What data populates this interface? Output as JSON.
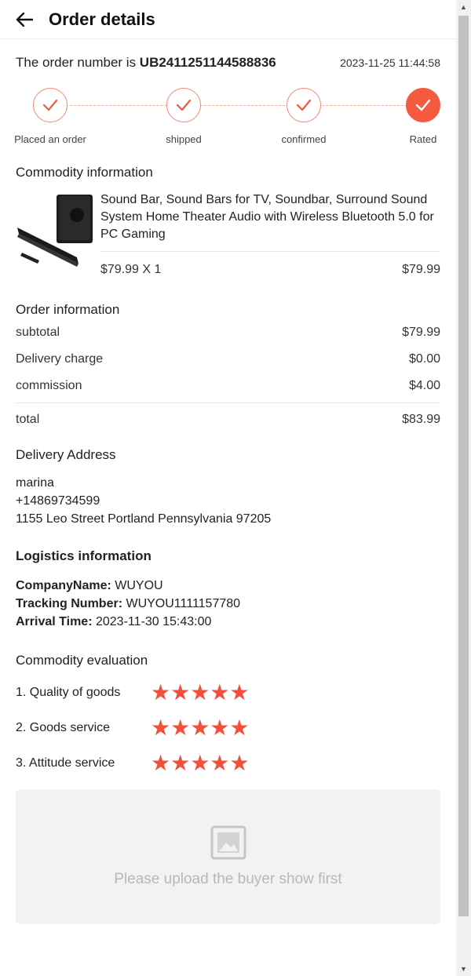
{
  "header": {
    "title": "Order details"
  },
  "order": {
    "label": "The order number is ",
    "number": "UB2411251144588836",
    "time": "2023-11-25 11:44:58"
  },
  "steps": [
    {
      "label": "Placed an order",
      "filled": false
    },
    {
      "label": "shipped",
      "filled": false
    },
    {
      "label": "confirmed",
      "filled": false
    },
    {
      "label": "Rated",
      "filled": true
    }
  ],
  "commodity": {
    "title": "Commodity information",
    "product_name": "Sound Bar, Sound Bars for TV, Soundbar, Surround Sound System Home Theater Audio with Wireless Bluetooth 5.0 for PC Gaming",
    "unit_price_qty": "$79.99  X  1",
    "line_total": "$79.99"
  },
  "order_info": {
    "title": "Order information",
    "rows": [
      {
        "label": "subtotal",
        "value": "$79.99"
      },
      {
        "label": "Delivery charge",
        "value": "$0.00"
      },
      {
        "label": "commission",
        "value": "$4.00"
      }
    ],
    "total_label": "total",
    "total_value": "$83.99"
  },
  "address": {
    "title": "Delivery Address",
    "name": "marina",
    "phone": "+14869734599",
    "street": "1155 Leo Street Portland Pennsylvania 97205"
  },
  "logistics": {
    "title": "Logistics information",
    "company_label": "CompanyName:",
    "company_value": " WUYOU",
    "tracking_label": "Tracking Number:",
    "tracking_value": " WUYOU1111157780",
    "arrival_label": "Arrival Time:",
    "arrival_value": " 2023-11-30 15:43:00"
  },
  "evaluation": {
    "title": "Commodity evaluation",
    "items": [
      {
        "label": "1. Quality of goods",
        "stars": "★★★★★",
        "rating": 5
      },
      {
        "label": "2. Goods service",
        "stars": "★★★★★",
        "rating": 5
      },
      {
        "label": "3. Attitude service",
        "stars": "★★★★★",
        "rating": 5
      }
    ]
  },
  "upload": {
    "text": "Please upload the buyer show first"
  },
  "colors": {
    "accent": "#f35a3f",
    "star": "#f2503a"
  }
}
